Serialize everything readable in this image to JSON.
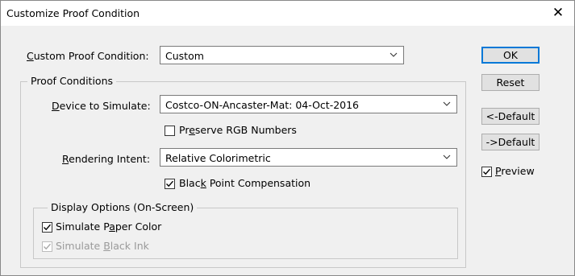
{
  "window": {
    "title": "Customize Proof Condition",
    "close_glyph": "✕"
  },
  "custom_proof_condition": {
    "label_prefix": "",
    "label_mnemonic": "C",
    "label_rest": "ustom Proof Condition:",
    "value": "Custom"
  },
  "proof_conditions": {
    "legend": "Proof Conditions",
    "device": {
      "label_mnemonic": "D",
      "label_rest": "evice to Simulate:",
      "value": "Costco-ON-Ancaster-Mat: 04-Oct-2016"
    },
    "preserve_rgb": {
      "label_pre": "Pr",
      "label_mnemonic": "e",
      "label_post": "serve RGB Numbers",
      "checked": false
    },
    "rendering": {
      "label_mnemonic": "R",
      "label_rest": "endering Intent:",
      "value": "Relative Colorimetric"
    },
    "black_point": {
      "label_pre": "Blac",
      "label_mnemonic": "k",
      "label_post": " Point Compensation",
      "checked": true
    }
  },
  "display_options": {
    "legend": "Display Options (On-Screen)",
    "paper_color": {
      "label_pre": "Simulate P",
      "label_mnemonic": "a",
      "label_post": "per Color",
      "checked": true
    },
    "black_ink": {
      "label_pre": "Simulate ",
      "label_mnemonic": "B",
      "label_post": "lack Ink",
      "checked": true,
      "disabled": true
    }
  },
  "buttons": {
    "ok": "OK",
    "reset": "Reset",
    "prev_default": "<-Default",
    "next_default": "->Default"
  },
  "preview": {
    "label_mnemonic": "P",
    "label_rest": "review",
    "checked": true
  },
  "icons": {
    "dropdown": "chevron-down-icon",
    "check": "checkmark-icon",
    "close": "close-icon"
  }
}
